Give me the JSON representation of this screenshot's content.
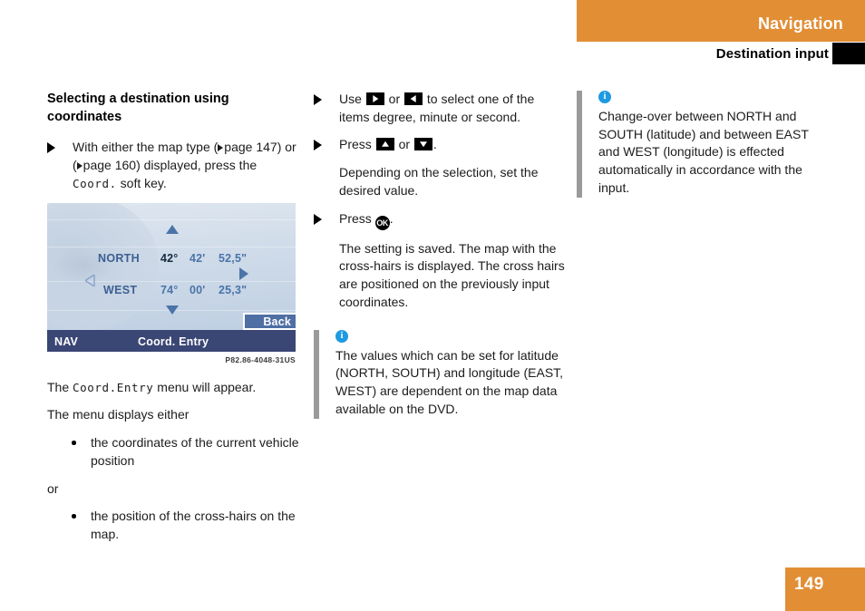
{
  "header": {
    "chapter_title": "Navigation",
    "section_title": "Destination input",
    "orange_hex": "#e28e35"
  },
  "left_column": {
    "heading": "Selecting a destination using coordinates",
    "step1": {
      "text_part1": "With either the map type (",
      "page_ref1": "page 147",
      "text_part2": ") or (",
      "page_ref2": "page 160",
      "text_part3": ") displayed, press the ",
      "softkey": "Coord.",
      "text_part4": " soft key."
    },
    "nav_screen": {
      "label_latitude": "NORTH",
      "label_longitude": "WEST",
      "latitude": {
        "degrees": "42°",
        "minutes": "42'",
        "seconds": "52,5\""
      },
      "longitude": {
        "degrees": "74°",
        "minutes": "00'",
        "seconds": "25,3\""
      },
      "softkey_back": "Back",
      "status_left": "NAV",
      "status_center": "Coord. Entry",
      "figure_code": "P82.86-4048-31US"
    },
    "after_figure": {
      "line1_pre": "The ",
      "line1_mono": "Coord.Entry",
      "line1_post": " menu will appear.",
      "line2": "The menu displays either",
      "bullet1": "the coordinates of the current vehicle position",
      "or_label": "or",
      "bullet2": "the position of the cross-hairs on the map."
    }
  },
  "mid_column": {
    "step1": {
      "pre": "Use ",
      "icon1": "arrow-right-key-icon",
      "mid": " or ",
      "icon2": "arrow-left-key-icon",
      "post": " to select one of the items degree, minute or second."
    },
    "step2": {
      "pre": "Press ",
      "icon1": "arrow-up-key-icon",
      "mid": " or ",
      "icon2": "arrow-down-key-icon",
      "post": "."
    },
    "para_after_step2": "Depending on the selection, set the desired value.",
    "step3": {
      "pre": "Press ",
      "icon": "ok-button-icon",
      "post": "."
    },
    "para_after_step3": "The setting is saved. The map with the cross-hairs is displayed. The cross hairs are positioned on the previously input coordinates.",
    "note": {
      "icon": "info-icon",
      "text": "The values which can be set for latitude (NORTH, SOUTH) and longitude (EAST, WEST) are dependent on the map data available on the DVD."
    }
  },
  "right_column": {
    "note": {
      "icon": "info-icon",
      "text": "Change-over between NORTH and SOUTH (latitude) and between EAST and WEST (longitude) is effected automatically in accordance with the input."
    }
  },
  "footer": {
    "page_number": "149"
  }
}
